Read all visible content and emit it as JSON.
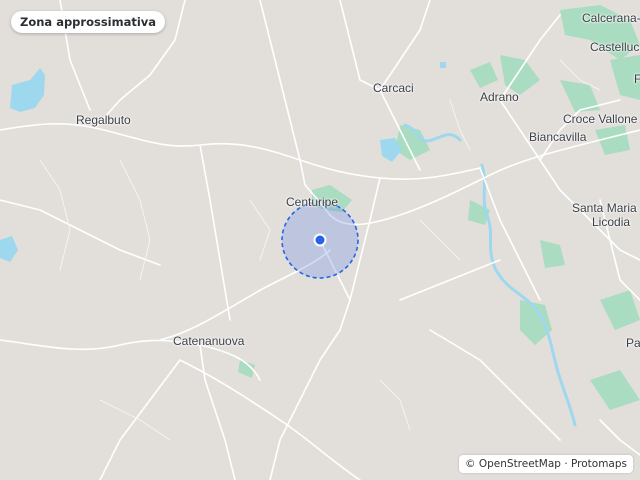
{
  "badge": {
    "label": "Zona approssimativa"
  },
  "places": [
    {
      "name": "Calcerana-"
    },
    {
      "name": "Castelluc"
    },
    {
      "name": "Carcaci"
    },
    {
      "name": "Adrano"
    },
    {
      "name": "Regalbuto"
    },
    {
      "name": "Croce Vallone"
    },
    {
      "name": "Biancavilla"
    },
    {
      "name": "Centuripe"
    },
    {
      "name": "Santa Maria"
    },
    {
      "name": "Licodia"
    },
    {
      "name": "Catenanuova"
    },
    {
      "name": "Pa"
    },
    {
      "name": "F"
    }
  ],
  "attribution": {
    "osm": "© OpenStreetMap",
    "sep": "·",
    "protomaps": "Protomaps"
  },
  "colors": {
    "land": "#e2dfdb",
    "road": "#ffffff",
    "water": "#9ed8ee",
    "park": "#a8dcc0",
    "marker": "#2563eb",
    "area_fill": "rgba(96,130,230,0.28)"
  }
}
